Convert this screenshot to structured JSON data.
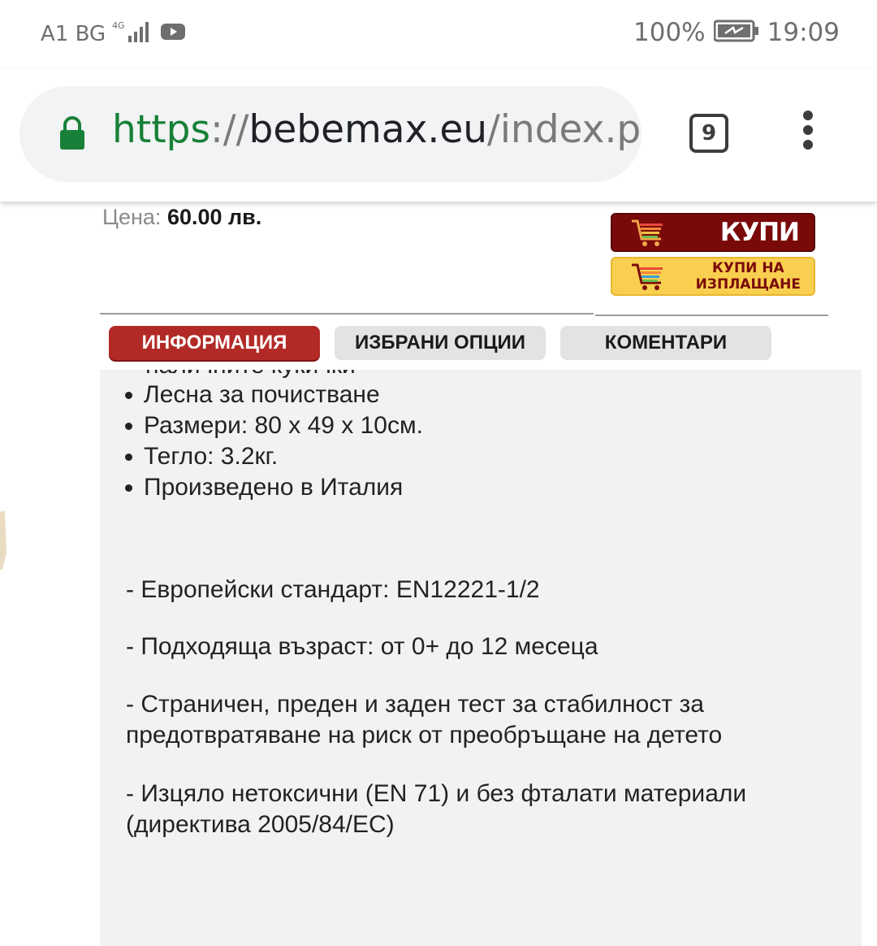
{
  "status_bar": {
    "carrier": "A1 BG",
    "network": "4G",
    "battery": "100%",
    "time": "19:09"
  },
  "browser": {
    "url_scheme": "https",
    "url_sep": "://",
    "url_host": "bebemax.eu",
    "url_path": "/index.ph",
    "tab_count": "9"
  },
  "product": {
    "price_label": "Цена:",
    "price_value": "60.00 лв.",
    "buy_label": "КУПИ",
    "lease_label_line1": "КУПИ НА",
    "lease_label_line2": "ИЗПЛАЩАНЕ"
  },
  "tabs": [
    {
      "label": "ИНФОРМАЦИЯ",
      "active": true
    },
    {
      "label": "ИЗБРАНИ ОПЦИИ",
      "active": false
    },
    {
      "label": "КОМЕНТАРИ",
      "active": false
    }
  ],
  "description": {
    "cut_line": "наличните кукички",
    "features": [
      "Лесна за почистване",
      "Размери: 80 x 49 x 10см.",
      "Тегло: 3.2кг.",
      "Произведено в Италия"
    ],
    "specs": [
      "- Европейски стандарт: EN12221-1/2",
      "- Подходяща възраст: от 0+ до 12 месеца",
      "- Страничен, преден и заден тест за стабилност за",
      "предотвратяване на риск от преобръщане на детето",
      "- Изцяло нетоксични (EN 71)  и без фталати материали",
      "(директива 2005/84/ЕС)"
    ]
  },
  "colors": {
    "active_tab": "#b22a26",
    "buy_button": "#7a0a0a",
    "lease_button": "#f8cf4e",
    "url_scheme": "#188038"
  }
}
